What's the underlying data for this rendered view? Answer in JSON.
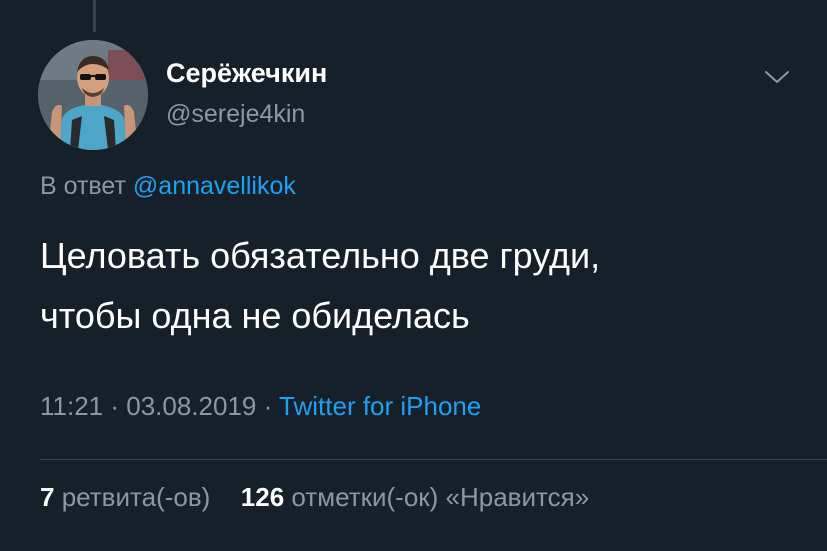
{
  "author": {
    "display_name": "Серёжечкин",
    "handle": "@sereje4kin"
  },
  "reply": {
    "prefix": "В ответ",
    "mention": "@annavellikok"
  },
  "tweet": {
    "lines": [
      "Целовать обязательно две груди,",
      "чтобы одна не обиделась"
    ]
  },
  "meta": {
    "time": "11:21",
    "separator": " · ",
    "date": "03.08.2019",
    "source": "Twitter for iPhone"
  },
  "stats": {
    "retweets_count": "7",
    "retweets_label": "ретвита(-ов)",
    "likes_count": "126",
    "likes_label": "отметки(-ок) «Нравится»"
  },
  "icons": {
    "menu": "chevron-down-icon",
    "avatar": "avatar"
  },
  "colors": {
    "background": "#15202b",
    "accent": "#1da1f2",
    "secondary_text": "#8899a6",
    "divider": "#38444d"
  }
}
